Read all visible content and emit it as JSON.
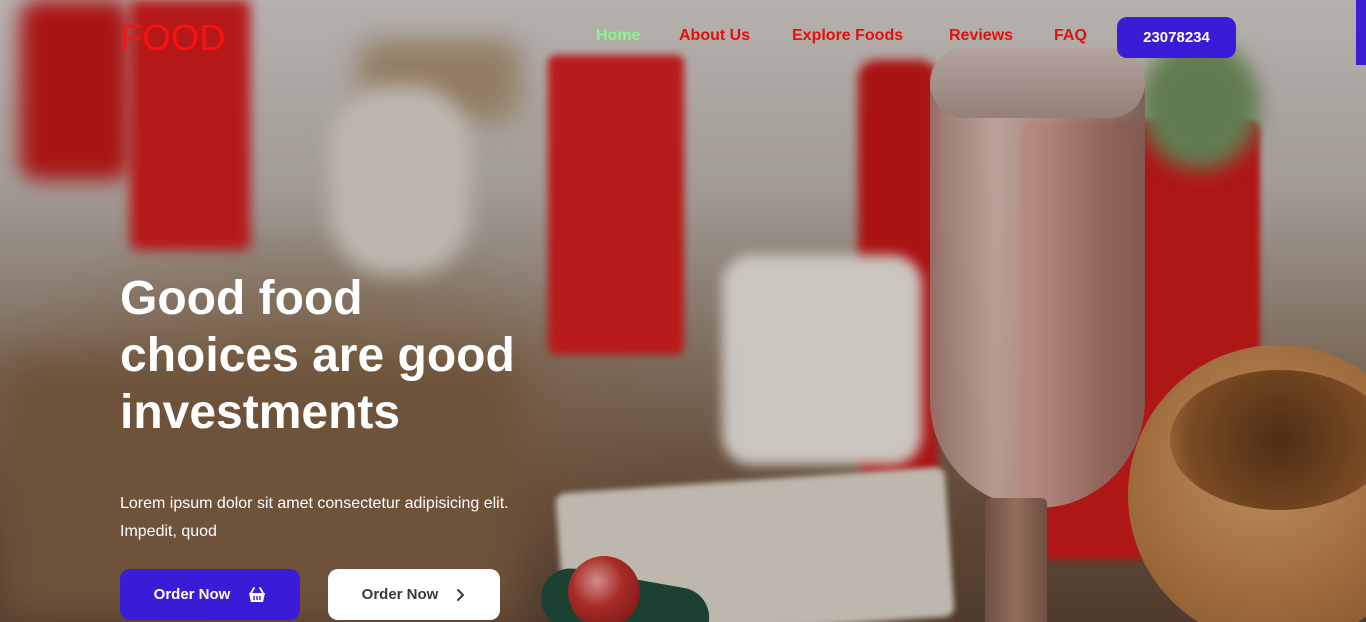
{
  "header": {
    "logo": "FOOD",
    "nav": [
      {
        "label": "Home",
        "active": true
      },
      {
        "label": "About Us",
        "active": false
      },
      {
        "label": "Explore Foods",
        "active": false
      },
      {
        "label": "Reviews",
        "active": false
      },
      {
        "label": "FAQ",
        "active": false
      }
    ],
    "phone_button": "23078234"
  },
  "hero": {
    "headline_lines": [
      "Good food",
      "choices are good",
      "investments"
    ],
    "lead_lines": [
      "Lorem ipsum dolor sit amet consectetur adipisicing elit.",
      "Impedit, quod"
    ],
    "primary_button": {
      "label": "Order Now",
      "icon": "basket-icon"
    },
    "secondary_button": {
      "label": "Order Now",
      "icon": "chevron-right-icon"
    }
  },
  "colors": {
    "accent": "#3a1bd6",
    "logo": "#ff1010",
    "nav_link": "#e60f0f",
    "nav_active": "#8cf58c"
  }
}
